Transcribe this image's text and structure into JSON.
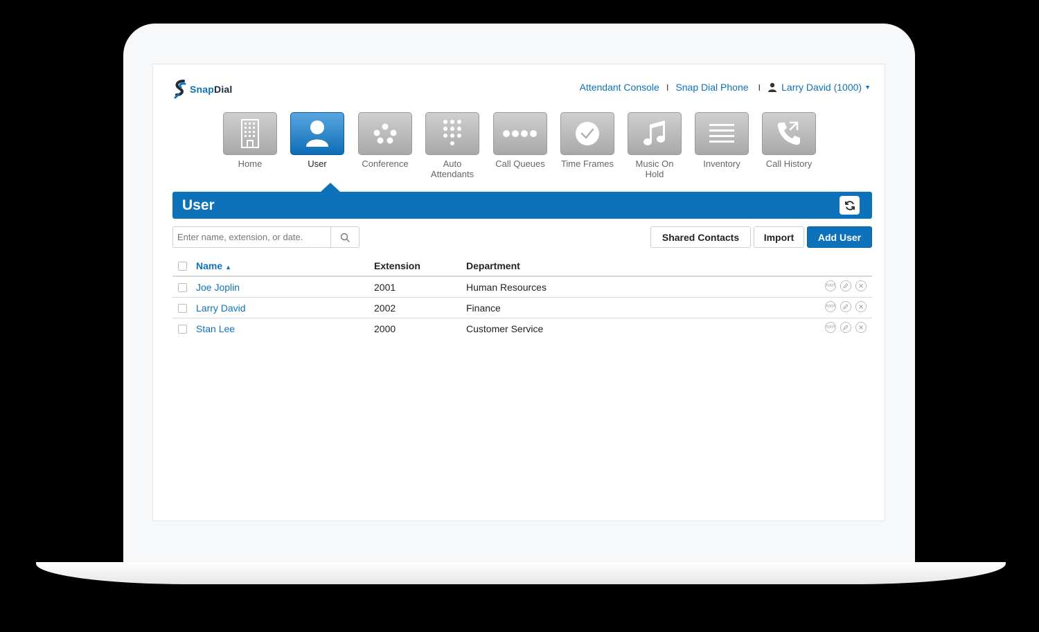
{
  "app": {
    "brand": {
      "snap": "Snap",
      "dial": "Dial"
    }
  },
  "topnav": {
    "attendant_console": "Attendant Console",
    "separator": "I",
    "snap_dial_phone": "Snap Dial Phone",
    "user_label": "Larry David (1000)"
  },
  "tiles": [
    {
      "label": "Home",
      "icon": "building-icon",
      "active": false
    },
    {
      "label": "User",
      "icon": "user-icon",
      "active": true
    },
    {
      "label": "Conference",
      "icon": "conference-dots-icon",
      "active": false
    },
    {
      "label": "Auto Attendants",
      "icon": "keypad-icon",
      "active": false
    },
    {
      "label": "Call Queues",
      "icon": "queue-dots-icon",
      "active": false
    },
    {
      "label": "Time Frames",
      "icon": "check-circle-icon",
      "active": false
    },
    {
      "label": "Music On Hold",
      "icon": "music-note-icon",
      "active": false
    },
    {
      "label": "Inventory",
      "icon": "list-lines-icon",
      "active": false
    },
    {
      "label": "Call History",
      "icon": "phone-history-icon",
      "active": false
    }
  ],
  "section": {
    "title": "User"
  },
  "search": {
    "placeholder": "Enter name, extension, or date."
  },
  "buttons": {
    "shared_contacts": "Shared Contacts",
    "import": "Import",
    "add_user": "Add User"
  },
  "table": {
    "headers": {
      "name": "Name",
      "extension": "Extension",
      "department": "Department"
    },
    "rows": [
      {
        "name": "Joe Joplin",
        "extension": "2001",
        "department": "Human Resources"
      },
      {
        "name": "Larry David",
        "extension": "2002",
        "department": "Finance"
      },
      {
        "name": "Stan Lee",
        "extension": "2000",
        "department": "Customer Service"
      }
    ],
    "row_action_badge": "TOOT"
  },
  "colors": {
    "primary": "#0d72b9",
    "tile_gray": "#b5b5b5"
  }
}
